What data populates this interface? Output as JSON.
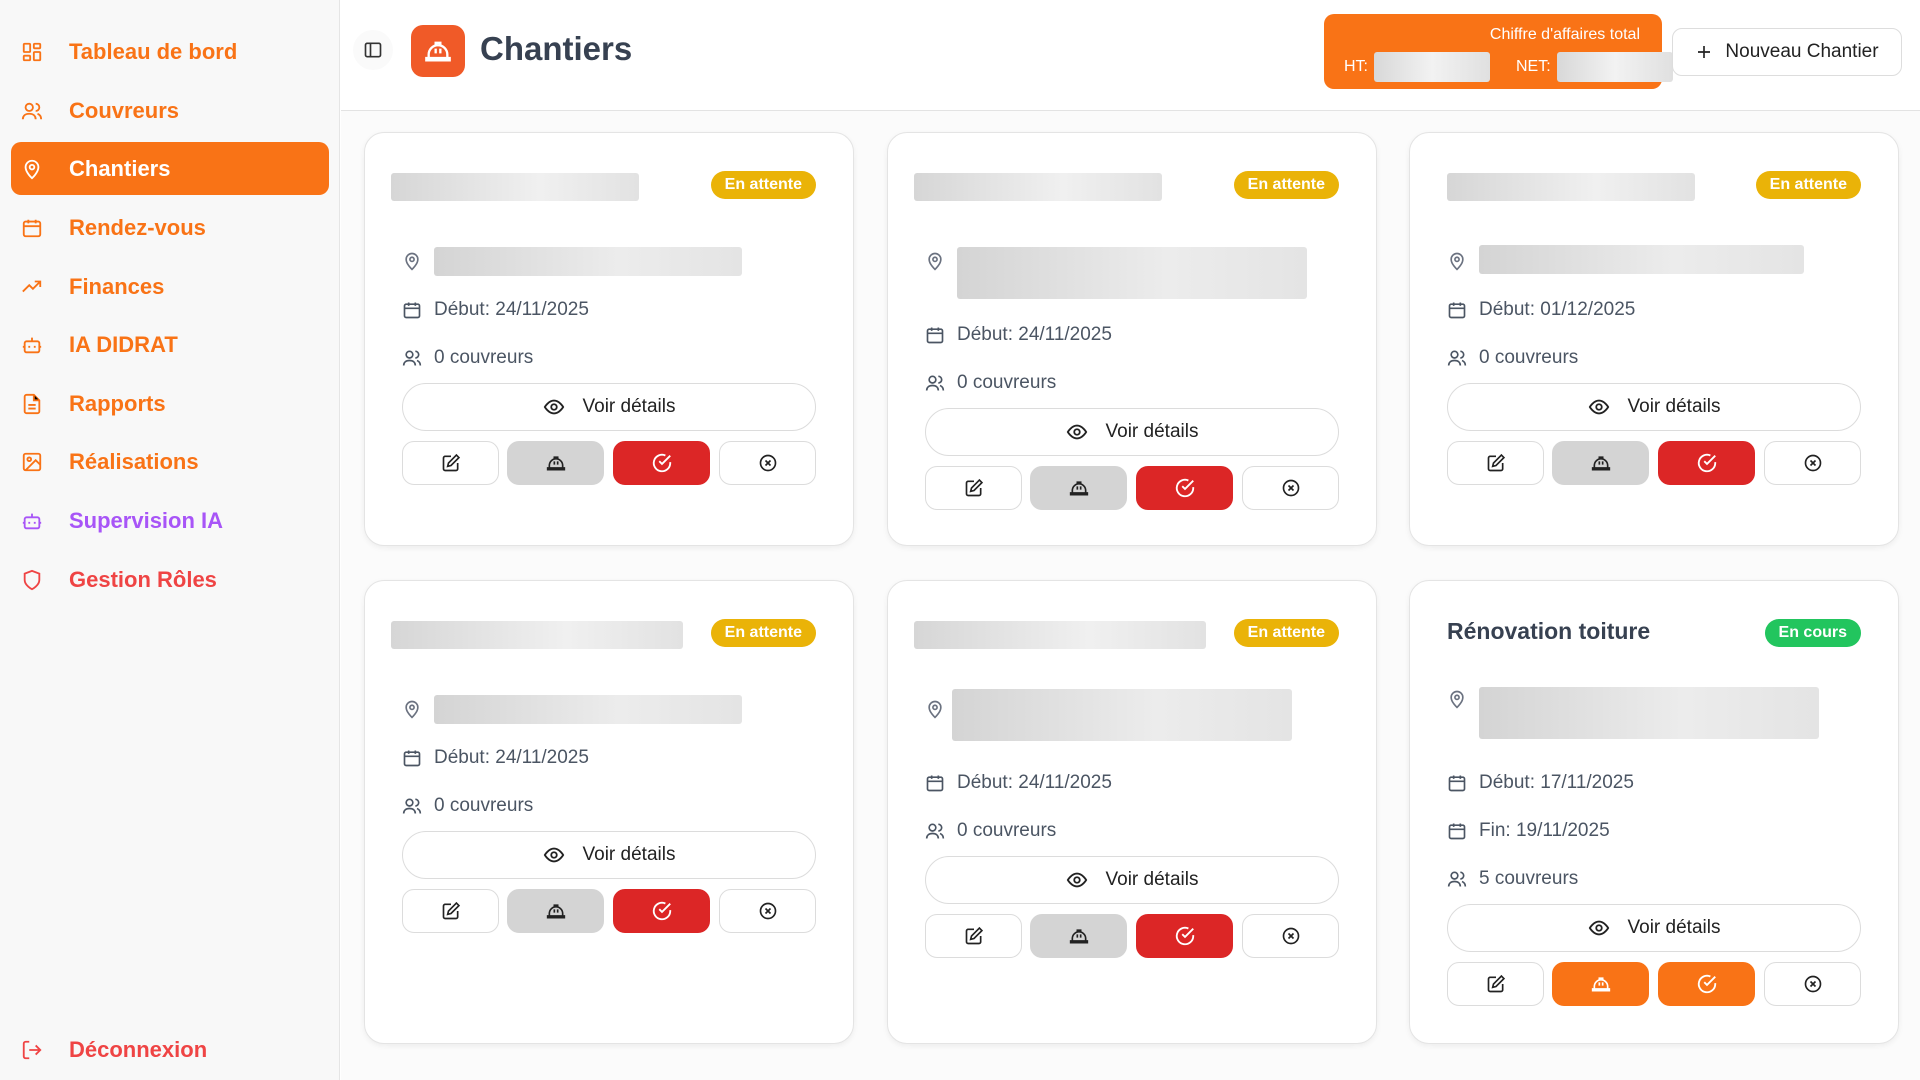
{
  "sidebar": {
    "items": [
      {
        "label": "Tableau de bord",
        "icon": "dashboard-icon"
      },
      {
        "label": "Couvreurs",
        "icon": "users-icon"
      },
      {
        "label": "Chantiers",
        "icon": "map-pin-icon",
        "active": true
      },
      {
        "label": "Rendez-vous",
        "icon": "calendar-icon"
      },
      {
        "label": "Finances",
        "icon": "trending-up-icon"
      },
      {
        "label": "IA DIDRAT",
        "icon": "bot-icon"
      },
      {
        "label": "Rapports",
        "icon": "file-text-icon"
      },
      {
        "label": "Réalisations",
        "icon": "image-icon"
      },
      {
        "label": "Supervision IA",
        "icon": "bot-icon"
      },
      {
        "label": "Gestion Rôles",
        "icon": "shield-icon"
      }
    ],
    "logout": "Déconnexion"
  },
  "header": {
    "title": "Chantiers",
    "revenue": {
      "title": "Chiffre d'affaires total",
      "ht_label": "HT:",
      "net_label": "NET:"
    },
    "new_button": "Nouveau Chantier"
  },
  "cards": [
    {
      "title": "",
      "status": "En attente",
      "debut": "Début: 24/11/2025",
      "couvreurs": "0 couvreurs",
      "view": "Voir détails"
    },
    {
      "title": "",
      "status": "En attente",
      "debut": "Début: 24/11/2025",
      "couvreurs": "0 couvreurs",
      "view": "Voir détails"
    },
    {
      "title": "",
      "status": "En attente",
      "debut": "Début: 01/12/2025",
      "couvreurs": "0 couvreurs",
      "view": "Voir détails"
    },
    {
      "title": "",
      "status": "En attente",
      "debut": "Début: 24/11/2025",
      "couvreurs": "0 couvreurs",
      "view": "Voir détails"
    },
    {
      "title": "",
      "status": "En attente",
      "debut": "Début: 24/11/2025",
      "couvreurs": "0 couvreurs",
      "view": "Voir détails"
    },
    {
      "title": "Rénovation toiture",
      "status": "En cours",
      "debut": "Début: 17/11/2025",
      "fin": "Fin: 19/11/2025",
      "couvreurs": "5 couvreurs",
      "view": "Voir détails"
    }
  ],
  "colors": {
    "accent": "#f97316",
    "danger": "#dc2626",
    "pending": "#eab308",
    "active": "#22c55e",
    "purple": "#a855f7"
  }
}
